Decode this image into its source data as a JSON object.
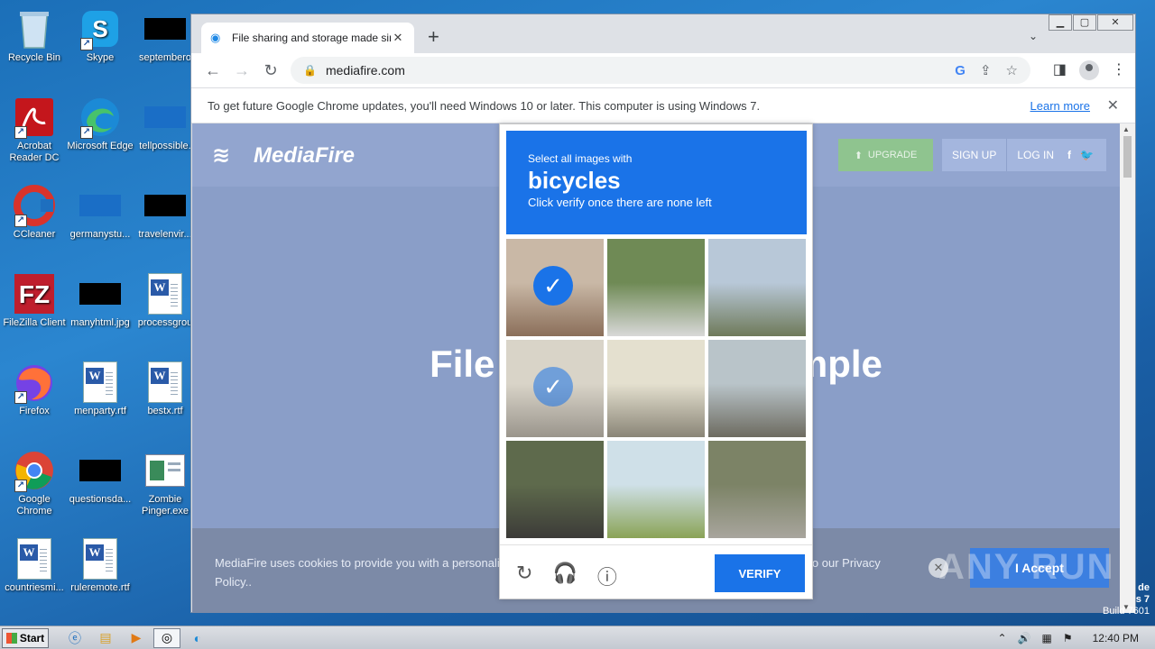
{
  "desktop": {
    "icons": [
      {
        "label": "Recycle Bin"
      },
      {
        "label": "Skype"
      },
      {
        "label": "septembero"
      },
      {
        "label": "Acrobat Reader DC"
      },
      {
        "label": "Microsoft Edge"
      },
      {
        "label": "tellpossible."
      },
      {
        "label": "CCleaner"
      },
      {
        "label": "germanystu..."
      },
      {
        "label": "travelenvir..."
      },
      {
        "label": "FileZilla Client"
      },
      {
        "label": "manyhtml.jpg"
      },
      {
        "label": "processgrou"
      },
      {
        "label": "Firefox"
      },
      {
        "label": "menparty.rtf"
      },
      {
        "label": "bestx.rtf"
      },
      {
        "label": "Google Chrome"
      },
      {
        "label": "questionsda..."
      },
      {
        "label": "Zombie Pinger.exe"
      },
      {
        "label": "countriesmi..."
      },
      {
        "label": "ruleremote.rtf"
      }
    ]
  },
  "browser": {
    "tab_title": "File sharing and storage made simple",
    "url": "mediafire.com",
    "infobar_text": "To get future Google Chrome updates, you'll need Windows 10 or later. This computer is using Windows 7.",
    "infobar_link": "Learn more"
  },
  "mediafire": {
    "logo": "MediaFire",
    "upgrade": "UPGRADE",
    "sign_up": "SIGN UP",
    "log_in": "LOG IN",
    "hero": "File storage made simple",
    "cookie_text": "MediaFire uses cookies to provide you with a personalized experience. By continuing to use MediaFire, you agree to our Privacy Policy..",
    "accept": "I Accept"
  },
  "captcha": {
    "prompt_small": "Select all images with",
    "prompt_big": "bicycles",
    "prompt_sub": "Click verify once there are none left",
    "verify": "VERIFY",
    "tiles": [
      {
        "colors": [
          "#c9b8a6",
          "#8b6f5a"
        ],
        "selected": true
      },
      {
        "colors": [
          "#6f8a55",
          "#d8d8d8"
        ],
        "selected": false
      },
      {
        "colors": [
          "#b8c8d8",
          "#6f7a5a"
        ],
        "selected": false
      },
      {
        "colors": [
          "#d9d4c8",
          "#9a958c"
        ],
        "selected": true
      },
      {
        "colors": [
          "#e4e0cf",
          "#8a8577"
        ],
        "selected": false
      },
      {
        "colors": [
          "#b9c4c9",
          "#6d6b60"
        ],
        "selected": false
      },
      {
        "colors": [
          "#5e6a4c",
          "#3c3b38"
        ],
        "selected": false
      },
      {
        "colors": [
          "#cfe0e8",
          "#8aa356"
        ],
        "selected": false
      },
      {
        "colors": [
          "#7c8366",
          "#a8a59d"
        ],
        "selected": false
      }
    ]
  },
  "taskbar": {
    "start": "Start",
    "clock": "12:40 PM"
  },
  "os": {
    "line1": "de",
    "line2": "s 7",
    "build": "Build 7601"
  },
  "watermark": "ANY RUN"
}
